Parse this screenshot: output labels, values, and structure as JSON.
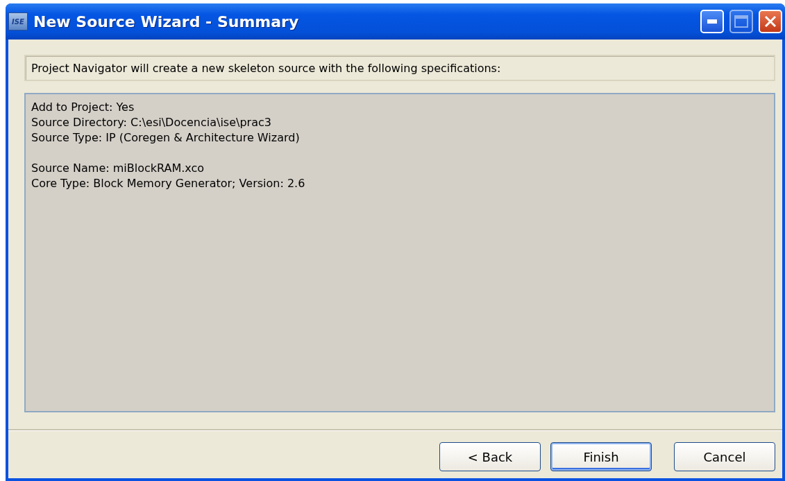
{
  "window": {
    "title": "New Source Wizard - Summary",
    "icon_text": "ISE",
    "controls": [
      {
        "kind": "minimize",
        "disabled": false
      },
      {
        "kind": "maximize",
        "disabled": true
      },
      {
        "kind": "close",
        "disabled": false
      }
    ]
  },
  "header": "Project Navigator will create a new skeleton source with the following specifications:",
  "summary": [
    [
      "Add to Project: Yes",
      "Source Directory: C:\\esi\\Docencia\\ise\\prac3",
      "Source Type: IP (Coregen & Architecture Wizard)"
    ],
    [
      "Source Name: miBlockRAM.xco",
      "Core Type: Block Memory Generator; Version: 2.6"
    ]
  ],
  "buttons": [
    {
      "label": "< Back",
      "default": false
    },
    {
      "label": "Finish",
      "default": true
    },
    {
      "label": "Cancel",
      "default": false
    }
  ]
}
